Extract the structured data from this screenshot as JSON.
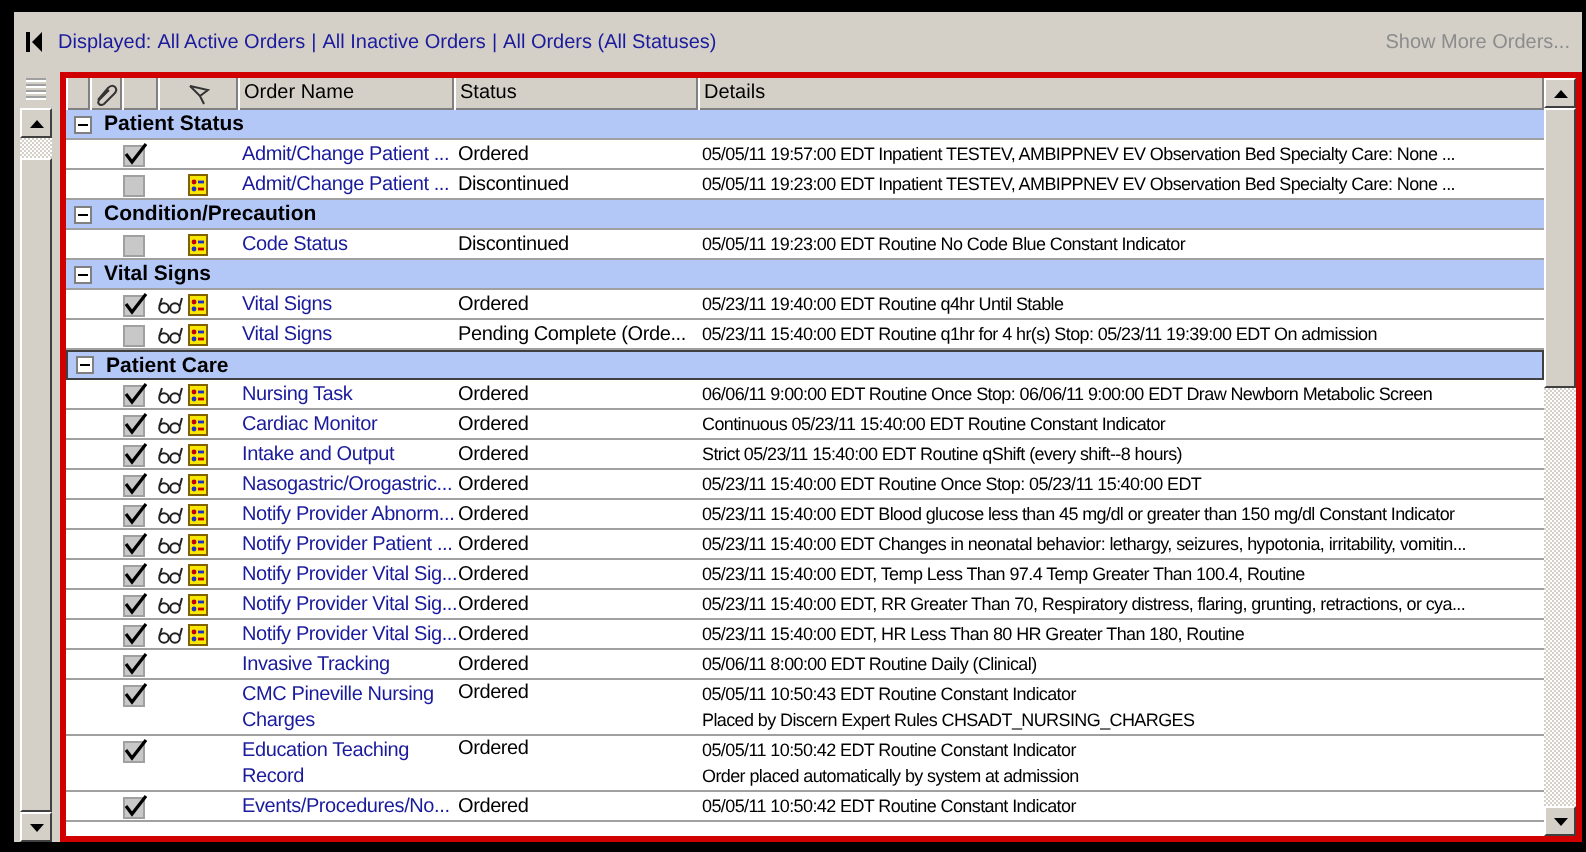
{
  "toolbar": {
    "display_label": "Displayed:",
    "separator": "|",
    "filters": [
      {
        "label": "All Active Orders"
      },
      {
        "label": "All Inactive Orders"
      },
      {
        "label": "All Orders (All Statuses)"
      }
    ],
    "show_more": {
      "label": "Show More Orders...",
      "disabled": true
    }
  },
  "table": {
    "columns": [
      "Order Name",
      "Status",
      "Details"
    ],
    "groups": [
      {
        "name": "Patient Status",
        "expanded": true,
        "selected": false,
        "rows": [
          {
            "checked": true,
            "glasses": false,
            "doc": false,
            "name": "Admit/Change Patient ...",
            "status": "Ordered",
            "details": "05/05/11 19:57:00 EDT Inpatient TESTEV, AMBIPPNEV EV Observation Bed Specialty Care: None ..."
          },
          {
            "checked": false,
            "glasses": false,
            "doc": true,
            "name": "Admit/Change Patient ...",
            "status": "Discontinued",
            "details": "05/05/11 19:23:00 EDT Inpatient TESTEV, AMBIPPNEV EV Observation Bed Specialty Care: None ..."
          }
        ]
      },
      {
        "name": "Condition/Precaution",
        "expanded": true,
        "selected": false,
        "rows": [
          {
            "checked": false,
            "glasses": false,
            "doc": true,
            "name": "Code Status",
            "status": "Discontinued",
            "details": "05/05/11 19:23:00 EDT Routine No Code Blue Constant Indicator"
          }
        ]
      },
      {
        "name": "Vital Signs",
        "expanded": true,
        "selected": false,
        "rows": [
          {
            "checked": true,
            "glasses": true,
            "doc": true,
            "name": "Vital Signs",
            "status": "Ordered",
            "details": "05/23/11 19:40:00 EDT Routine q4hr Until Stable"
          },
          {
            "checked": false,
            "glasses": true,
            "doc": true,
            "name": "Vital Signs",
            "status": "Pending Complete (Orde...",
            "details": "05/23/11 15:40:00 EDT Routine q1hr for 4 hr(s) Stop: 05/23/11 19:39:00 EDT On admission"
          }
        ]
      },
      {
        "name": "Patient Care",
        "expanded": true,
        "selected": true,
        "rows": [
          {
            "checked": true,
            "glasses": true,
            "doc": true,
            "name": "Nursing Task",
            "status": "Ordered",
            "details": "06/06/11 9:00:00 EDT Routine Once Stop: 06/06/11 9:00:00 EDT Draw Newborn Metabolic Screen"
          },
          {
            "checked": true,
            "glasses": true,
            "doc": true,
            "name": "Cardiac Monitor",
            "status": "Ordered",
            "details": "Continuous 05/23/11 15:40:00 EDT Routine Constant Indicator"
          },
          {
            "checked": true,
            "glasses": true,
            "doc": true,
            "name": "Intake and Output",
            "status": "Ordered",
            "details": "Strict 05/23/11 15:40:00 EDT Routine qShift (every shift--8 hours)"
          },
          {
            "checked": true,
            "glasses": true,
            "doc": true,
            "name": "Nasogastric/Orogastric...",
            "status": "Ordered",
            "details": "05/23/11 15:40:00 EDT Routine Once Stop: 05/23/11 15:40:00 EDT"
          },
          {
            "checked": true,
            "glasses": true,
            "doc": true,
            "name": "Notify Provider Abnorm...",
            "status": "Ordered",
            "details": "05/23/11 15:40:00 EDT Blood glucose less than 45 mg/dl or greater than 150 mg/dl Constant Indicator"
          },
          {
            "checked": true,
            "glasses": true,
            "doc": true,
            "name": "Notify Provider Patient ...",
            "status": "Ordered",
            "details": "05/23/11 15:40:00 EDT Changes in neonatal behavior: lethargy, seizures, hypotonia, irritability, vomitin..."
          },
          {
            "checked": true,
            "glasses": true,
            "doc": true,
            "name": "Notify Provider Vital Sig...",
            "status": "Ordered",
            "details": "05/23/11 15:40:00 EDT, Temp Less Than 97.4 Temp Greater Than 100.4, Routine"
          },
          {
            "checked": true,
            "glasses": true,
            "doc": true,
            "name": "Notify Provider Vital Sig...",
            "status": "Ordered",
            "details": "05/23/11 15:40:00 EDT, RR Greater Than 70, Respiratory distress, flaring, grunting, retractions, or cya..."
          },
          {
            "checked": true,
            "glasses": true,
            "doc": true,
            "name": "Notify Provider Vital Sig...",
            "status": "Ordered",
            "details": "05/23/11 15:40:00 EDT, HR Less Than 80 HR Greater Than 180, Routine"
          },
          {
            "checked": true,
            "glasses": false,
            "doc": false,
            "name": "Invasive Tracking",
            "status": "Ordered",
            "details": "05/06/11 8:00:00 EDT Routine Daily (Clinical)"
          },
          {
            "checked": true,
            "glasses": false,
            "doc": false,
            "name": "CMC Pineville Nursing Charges",
            "status": "Ordered",
            "details": "05/05/11 10:50:43 EDT Routine Constant Indicator",
            "note": "Placed by Discern Expert Rules CHSADT_NURSING_CHARGES"
          },
          {
            "checked": true,
            "glasses": false,
            "doc": false,
            "name": "Education Teaching Record",
            "status": "Ordered",
            "details": "05/05/11 10:50:42 EDT Routine Constant Indicator",
            "note": "Order placed automatically by system at admission"
          },
          {
            "checked": true,
            "glasses": false,
            "doc": false,
            "name": "Events/Procedures/No...",
            "status": "Ordered",
            "details": "05/05/11 10:50:42 EDT Routine Constant Indicator"
          }
        ]
      }
    ]
  }
}
